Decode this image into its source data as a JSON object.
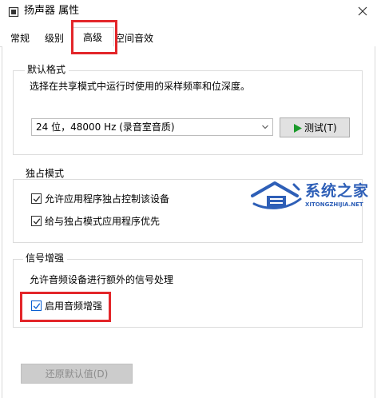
{
  "window": {
    "title": "扬声器 属性",
    "close_icon": "close-icon"
  },
  "tabs": [
    {
      "label": "常规"
    },
    {
      "label": "级别"
    },
    {
      "label": "高级",
      "selected": true
    },
    {
      "label": "空间音效"
    }
  ],
  "default_format": {
    "group_title": "默认格式",
    "description": "选择在共享模式中运行时使用的采样频率和位深度。",
    "format_value": "24 位，48000 Hz (录音室音质)",
    "test_button_label": "测试(T)"
  },
  "exclusive_mode": {
    "group_title": "独占模式",
    "options": [
      {
        "label": "允许应用程序独占控制该设备",
        "checked": true
      },
      {
        "label": "给与独占模式应用程序优先",
        "checked": true
      }
    ]
  },
  "signal_enhancement": {
    "group_title": "信号增强",
    "description": "允许音频设备进行额外的信号处理",
    "option": {
      "label": "启用音频增强",
      "checked": true
    }
  },
  "restore_button_label": "还原默认值(D)",
  "watermark": {
    "name": "系统之家",
    "url": "XITONGZHIJIA.NET"
  },
  "colors": {
    "highlight_red": "#e3262a",
    "play_green": "#1a9a2a",
    "watermark_blue": "#2e5fb7"
  }
}
